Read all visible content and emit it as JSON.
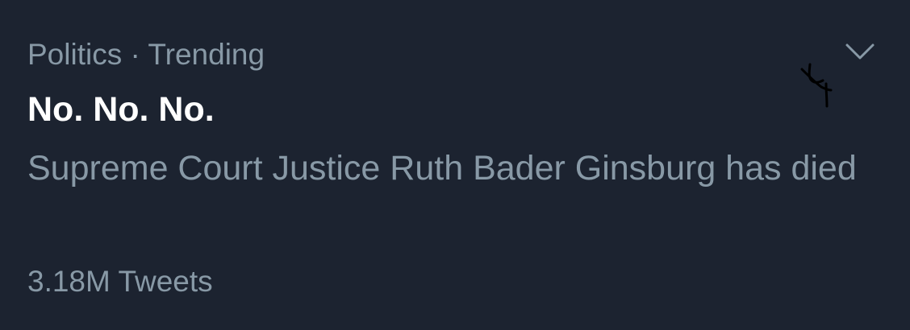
{
  "trend": {
    "context": "Politics · Trending",
    "headline": "No. No. No.",
    "description": "Supreme Court Justice Ruth Bader Ginsburg has died",
    "tweet_count": "3.18M Tweets"
  },
  "icons": {
    "more_options": "chevron-down-icon"
  },
  "colors": {
    "background": "#1c2330",
    "primary_text": "#ffffff",
    "secondary_text": "#8899a6",
    "icon": "#8899a6",
    "scribble": "#000000"
  }
}
